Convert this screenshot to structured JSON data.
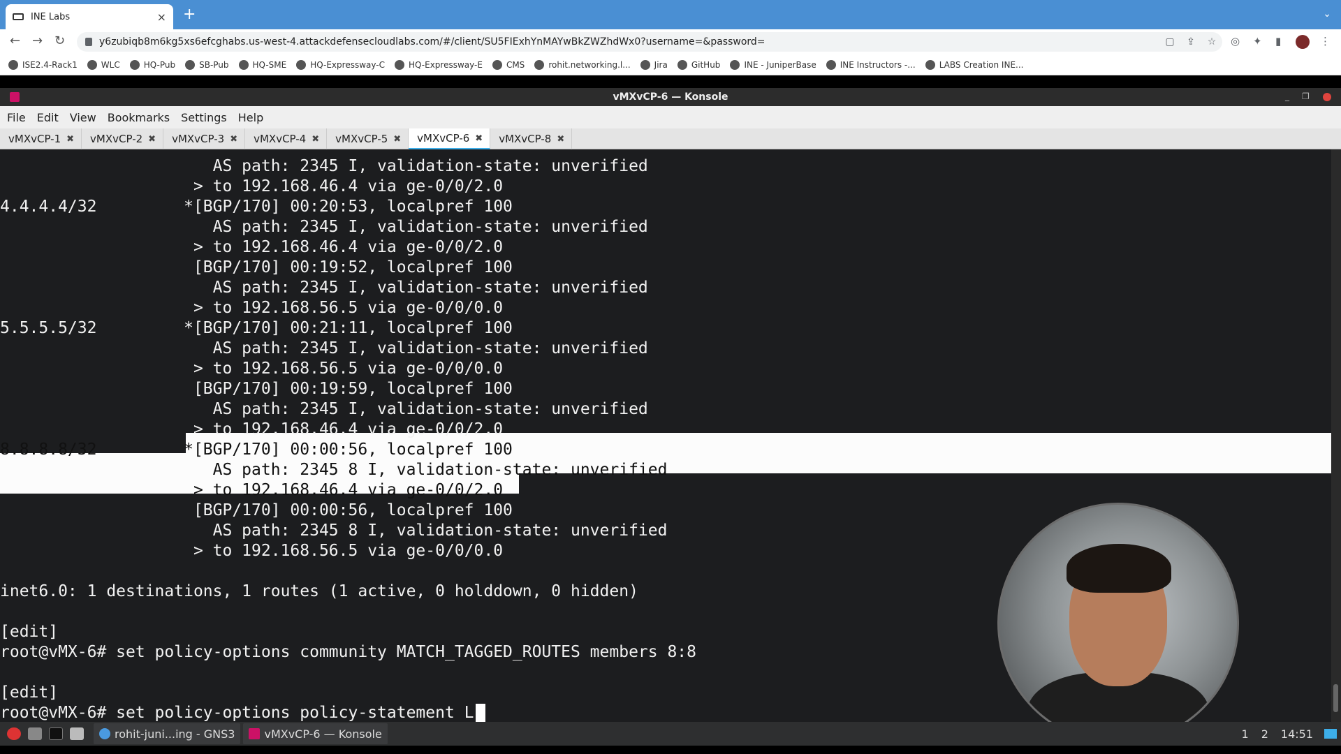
{
  "browser": {
    "tab_title": "INE Labs",
    "tab_close": "×",
    "new_tab": "+",
    "tab_menu": "⌄",
    "url": "y6zubiqb8m6kg5xs6efcghabs.us-west-4.attackdefensecloudlabs.com/#/client/SU5FIExhYnMAYwBkZWZhdWx0?username=&password=",
    "nav": {
      "back": "←",
      "forward": "→",
      "reload": "↻"
    },
    "bookmarks": [
      "ISE2.4-Rack1",
      "WLC",
      "HQ-Pub",
      "SB-Pub",
      "HQ-SME",
      "HQ-Expressway-C",
      "HQ-Expressway-E",
      "CMS",
      "rohit.networking.l...",
      "Jira",
      "GitHub",
      "INE - JuniperBase",
      "INE Instructors -...",
      "LABS Creation INE..."
    ]
  },
  "konsole": {
    "title": "vMXvCP-6 — Konsole",
    "menu": [
      "File",
      "Edit",
      "View",
      "Bookmarks",
      "Settings",
      "Help"
    ],
    "tabs": [
      {
        "label": "vMXvCP-1",
        "active": false
      },
      {
        "label": "vMXvCP-2",
        "active": false
      },
      {
        "label": "vMXvCP-3",
        "active": false
      },
      {
        "label": "vMXvCP-4",
        "active": false
      },
      {
        "label": "vMXvCP-5",
        "active": false
      },
      {
        "label": "vMXvCP-6",
        "active": true
      },
      {
        "label": "vMXvCP-8",
        "active": false
      }
    ],
    "tab_close_glyph": "✖",
    "terminal_lines": [
      "                      AS path: 2345 I, validation-state: unverified",
      "                    > to 192.168.46.4 via ge-0/0/2.0",
      "4.4.4.4/32         *[BGP/170] 00:20:53, localpref 100",
      "                      AS path: 2345 I, validation-state: unverified",
      "                    > to 192.168.46.4 via ge-0/0/2.0",
      "                    [BGP/170] 00:19:52, localpref 100",
      "                      AS path: 2345 I, validation-state: unverified",
      "                    > to 192.168.56.5 via ge-0/0/0.0",
      "5.5.5.5/32         *[BGP/170] 00:21:11, localpref 100",
      "                      AS path: 2345 I, validation-state: unverified",
      "                    > to 192.168.56.5 via ge-0/0/0.0",
      "                    [BGP/170] 00:19:59, localpref 100",
      "                      AS path: 2345 I, validation-state: unverified",
      "                    > to 192.168.46.4 via ge-0/0/2.0",
      "8.8.8.8/32         *[BGP/170] 00:00:56, localpref 100",
      "                      AS path: 2345 8 I, validation-state: unverified",
      "                    > to 192.168.46.4 via ge-0/0/2.0",
      "                    [BGP/170] 00:00:56, localpref 100",
      "                      AS path: 2345 8 I, validation-state: unverified",
      "                    > to 192.168.56.5 via ge-0/0/0.0",
      "",
      "inet6.0: 1 destinations, 1 routes (1 active, 0 holddown, 0 hidden)",
      "",
      "[edit]",
      "root@vMX-6# set policy-options community MATCH_TAGGED_ROUTES members 8:8",
      "",
      "[edit]",
      "root@vMX-6# set policy-options policy-statement L"
    ]
  },
  "taskbar": {
    "tasks": [
      "rohit-juni...ing - GNS3",
      "vMXvCP-6 — Konsole"
    ],
    "desktops": [
      "1",
      "2"
    ],
    "clock": "14:51"
  }
}
